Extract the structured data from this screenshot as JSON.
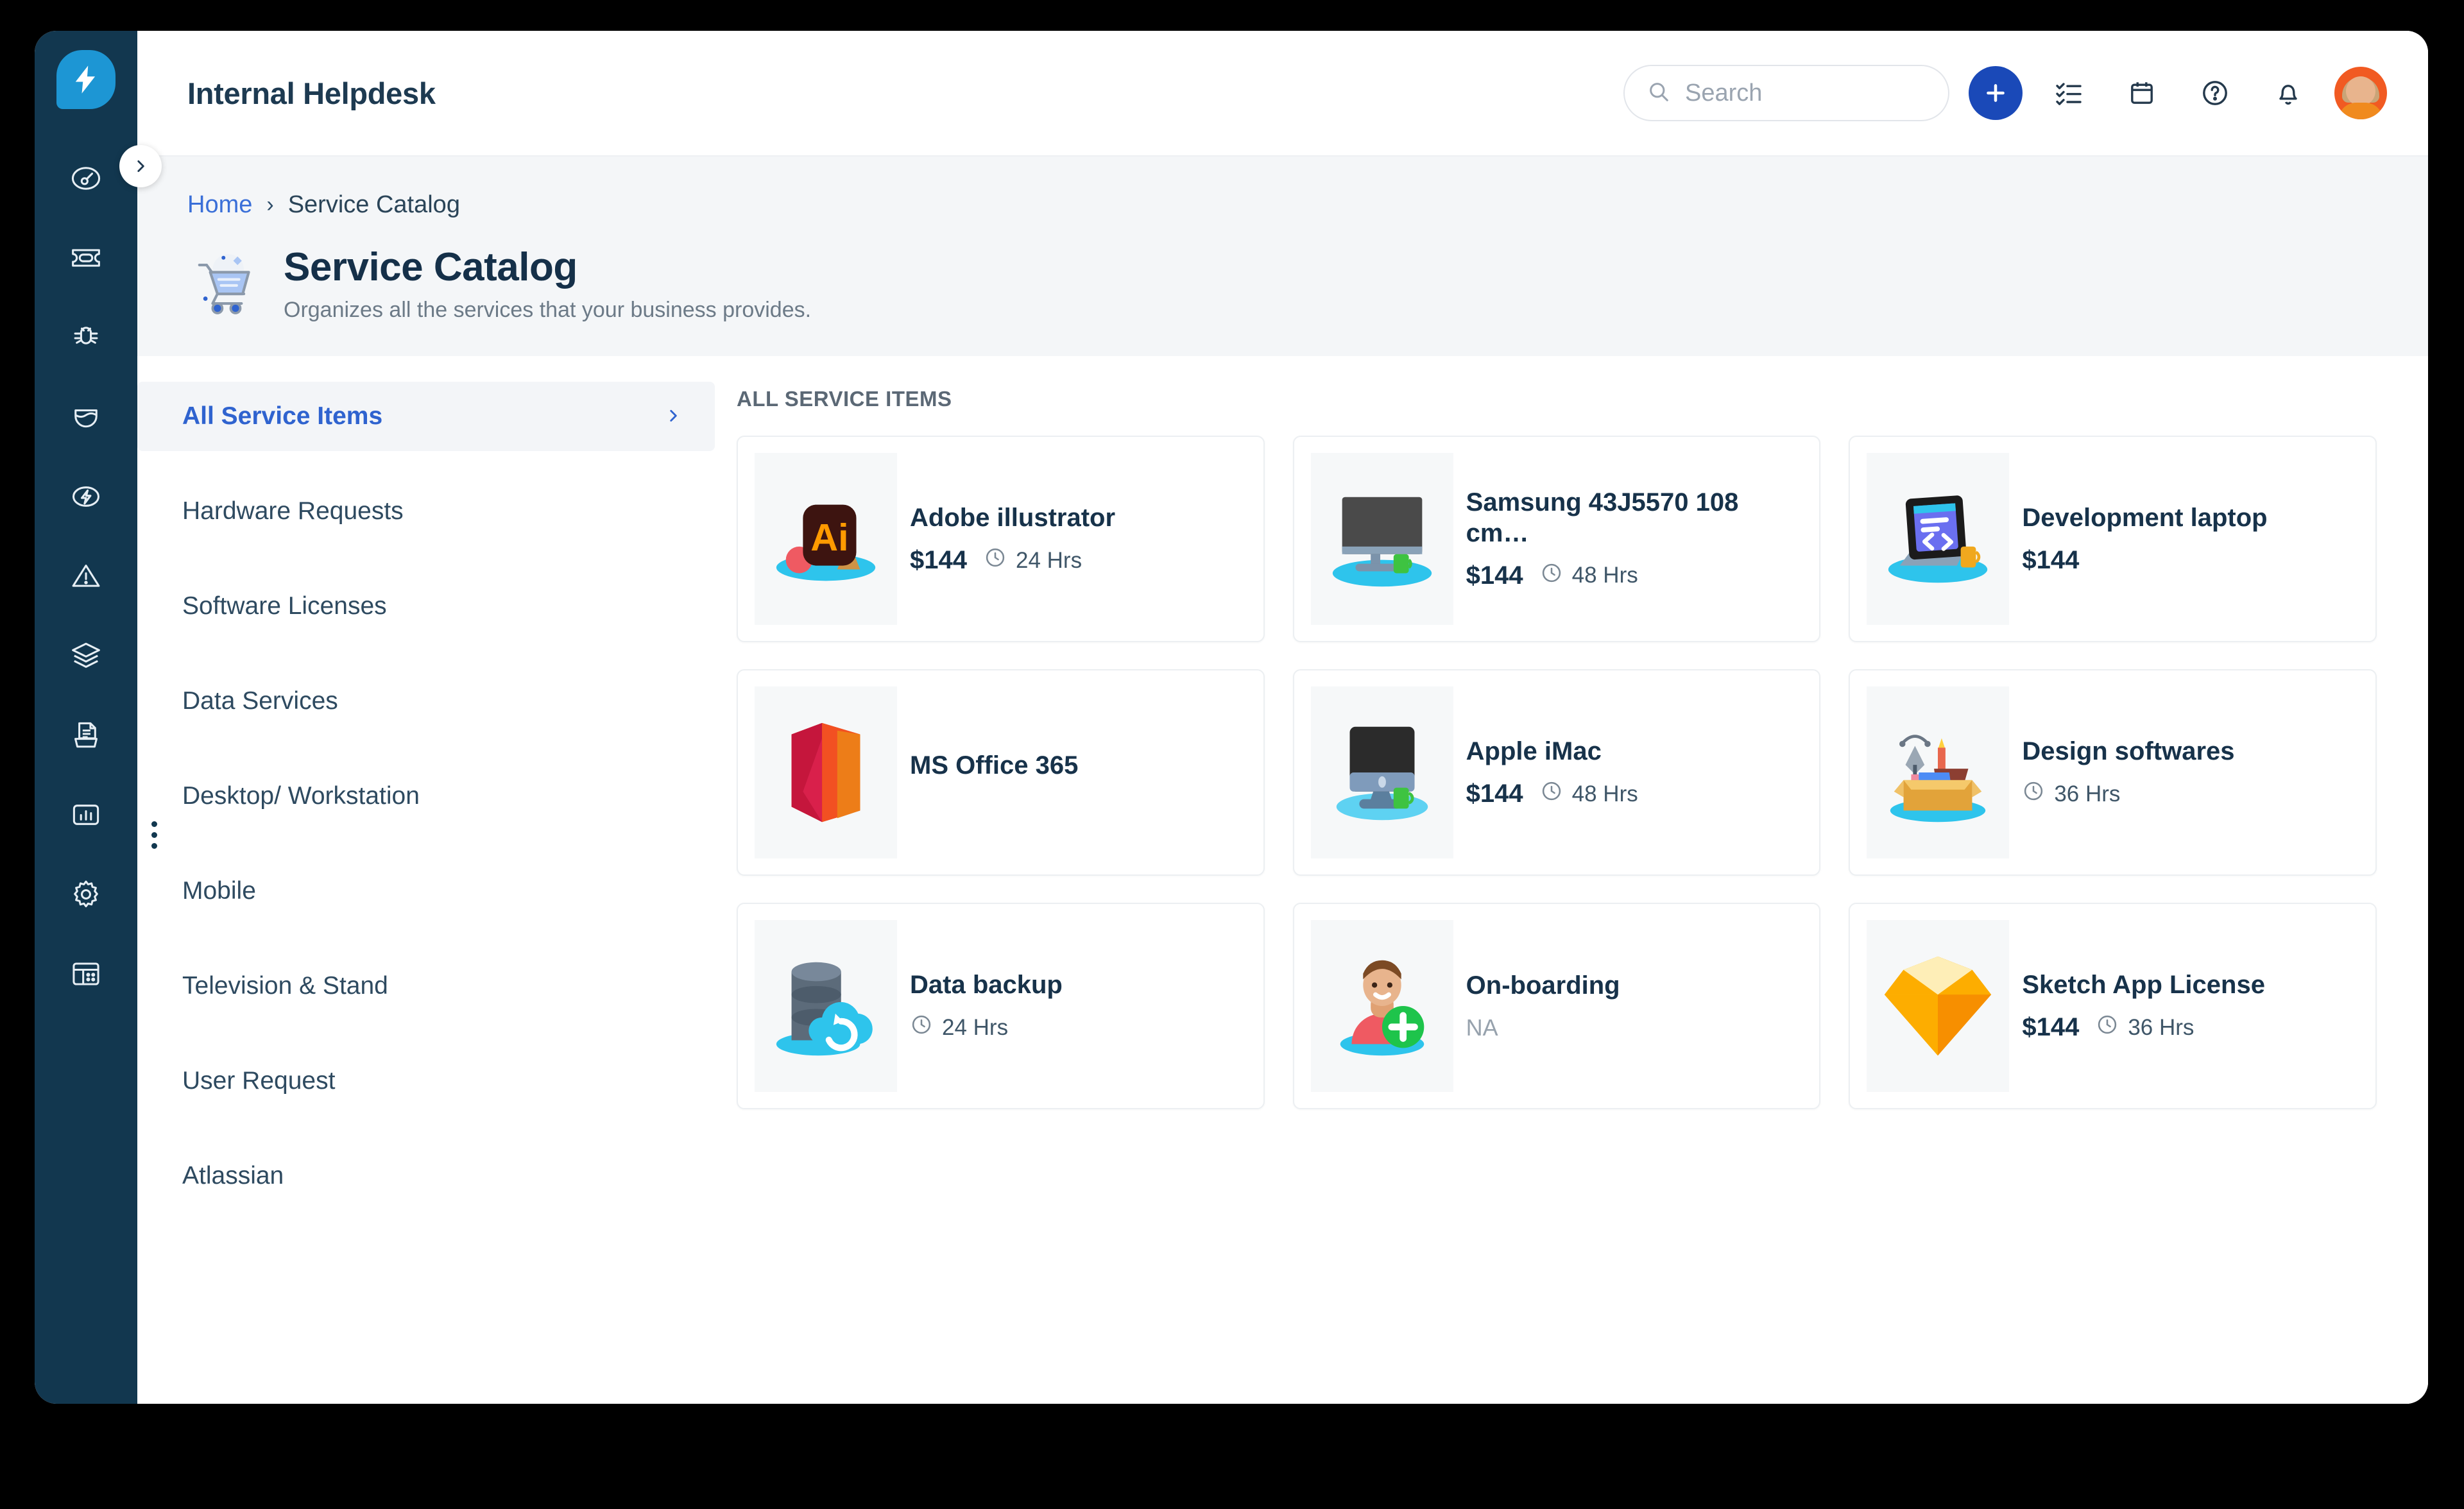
{
  "app": {
    "title": "Internal Helpdesk"
  },
  "topbar": {
    "search_placeholder": "Search",
    "add_label": "+",
    "icons": [
      {
        "name": "add-icon",
        "label": "Add"
      },
      {
        "name": "tasks-icon",
        "label": "Tasks"
      },
      {
        "name": "calendar-icon",
        "label": "Calendar"
      },
      {
        "name": "help-icon",
        "label": "Help"
      },
      {
        "name": "notifications-icon",
        "label": "Notifications"
      },
      {
        "name": "avatar",
        "label": "Profile"
      }
    ]
  },
  "rail": {
    "logo_name": "lightning-logo-icon",
    "expand_name": "expand-sidebar-icon",
    "items": [
      {
        "name": "dashboard-icon",
        "label": "Dashboard"
      },
      {
        "name": "ticket-icon",
        "label": "Tickets"
      },
      {
        "name": "bug-icon",
        "label": "Problems"
      },
      {
        "name": "shield-icon",
        "label": "Changes"
      },
      {
        "name": "flash-icon",
        "label": "Releases"
      },
      {
        "name": "alert-icon",
        "label": "Incidents"
      },
      {
        "name": "layers-icon",
        "label": "Assets"
      },
      {
        "name": "knowledge-base-icon",
        "label": "Solutions"
      },
      {
        "name": "reports-icon",
        "label": "Reports"
      },
      {
        "name": "settings-gear-icon",
        "label": "Admin"
      },
      {
        "name": "layout-icon",
        "label": "Workspace"
      }
    ]
  },
  "breadcrumb": {
    "home": "Home",
    "separator": "›",
    "current": "Service Catalog"
  },
  "page": {
    "icon_name": "shopping-cart-icon",
    "title": "Service Catalog",
    "subtitle": "Organizes all the services that your business provides."
  },
  "categories": [
    {
      "label": "All Service Items",
      "active": true
    },
    {
      "label": "Hardware Requests",
      "active": false
    },
    {
      "label": "Software Licenses",
      "active": false
    },
    {
      "label": "Data Services",
      "active": false
    },
    {
      "label": "Desktop/ Workstation",
      "active": false
    },
    {
      "label": "Mobile",
      "active": false
    },
    {
      "label": "Television & Stand",
      "active": false
    },
    {
      "label": "User Request",
      "active": false
    },
    {
      "label": "Atlassian",
      "active": false
    }
  ],
  "grid": {
    "heading": "ALL SERVICE ITEMS",
    "items": [
      {
        "title": "Adobe illustrator",
        "price": "$144",
        "time": "24 Hrs",
        "icon": "adobe-illustrator-icon",
        "has_price": true,
        "has_time": true,
        "na": ""
      },
      {
        "title": "Samsung 43J5570 108 cm…",
        "price": "$144",
        "time": "48 Hrs",
        "icon": "monitor-icon",
        "has_price": true,
        "has_time": true,
        "na": ""
      },
      {
        "title": "Development laptop",
        "price": "$144",
        "time": "",
        "icon": "dev-laptop-icon",
        "has_price": true,
        "has_time": false,
        "na": ""
      },
      {
        "title": "MS Office 365",
        "price": "",
        "time": "",
        "icon": "ms-office-icon",
        "has_price": false,
        "has_time": false,
        "na": ""
      },
      {
        "title": "Apple iMac",
        "price": "$144",
        "time": "48 Hrs",
        "icon": "imac-icon",
        "has_price": true,
        "has_time": true,
        "na": ""
      },
      {
        "title": "Design softwares",
        "price": "",
        "time": "36 Hrs",
        "icon": "design-box-icon",
        "has_price": false,
        "has_time": true,
        "na": ""
      },
      {
        "title": "Data backup",
        "price": "",
        "time": "24 Hrs",
        "icon": "data-backup-icon",
        "has_price": false,
        "has_time": true,
        "na": ""
      },
      {
        "title": "On-boarding",
        "price": "",
        "time": "",
        "icon": "onboarding-person-icon",
        "has_price": false,
        "has_time": false,
        "na": "NA"
      },
      {
        "title": "Sketch App License",
        "price": "$144",
        "time": "36 Hrs",
        "icon": "sketch-diamond-icon",
        "has_price": true,
        "has_time": true,
        "na": ""
      }
    ]
  },
  "colors": {
    "rail_bg": "#12374f",
    "logo_blue": "#1d96d4",
    "accent_blue": "#1a49b8",
    "link_blue": "#3a6fd8",
    "title_navy": "#17324a",
    "header_bg": "#f4f6f8",
    "avatar_orange": "#f15a22"
  }
}
